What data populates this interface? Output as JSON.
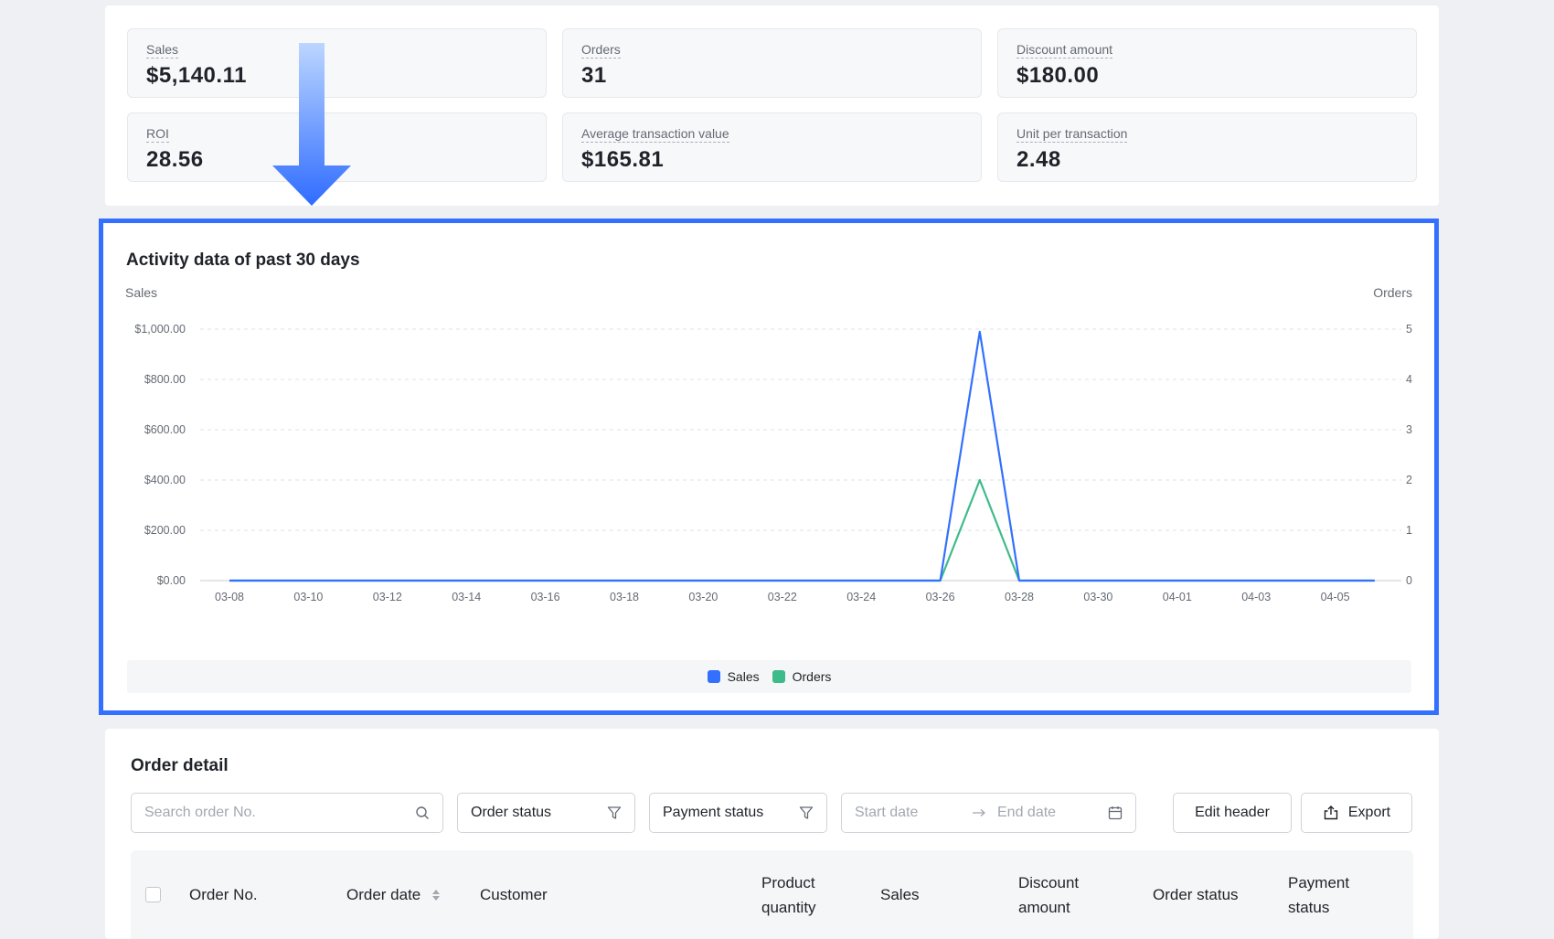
{
  "metrics": {
    "sales": {
      "label": "Sales",
      "value": "$5,140.11"
    },
    "orders": {
      "label": "Orders",
      "value": "31"
    },
    "discount": {
      "label": "Discount amount",
      "value": "$180.00"
    },
    "roi": {
      "label": "ROI",
      "value": "28.56"
    },
    "atv": {
      "label": "Average transaction value",
      "value": "$165.81"
    },
    "upt": {
      "label": "Unit per transaction",
      "value": "2.48"
    }
  },
  "chart": {
    "title": "Activity data of past 30 days"
  },
  "chart_data": {
    "type": "line",
    "title": "Activity data of past 30 days",
    "ylabel_left": "Sales",
    "ylabel_right": "Orders",
    "yticks_left": [
      "$0.00",
      "$200.00",
      "$400.00",
      "$600.00",
      "$800.00",
      "$1,000.00"
    ],
    "yticks_right": [
      "0",
      "1",
      "2",
      "3",
      "4",
      "5"
    ],
    "ylim_left": [
      0,
      1000
    ],
    "ylim_right": [
      0,
      5
    ],
    "xticks": [
      "03-08",
      "03-10",
      "03-12",
      "03-14",
      "03-16",
      "03-18",
      "03-20",
      "03-22",
      "03-24",
      "03-26",
      "03-28",
      "03-30",
      "04-01",
      "04-03",
      "04-05"
    ],
    "x": [
      "03-08",
      "03-09",
      "03-10",
      "03-11",
      "03-12",
      "03-13",
      "03-14",
      "03-15",
      "03-16",
      "03-17",
      "03-18",
      "03-19",
      "03-20",
      "03-21",
      "03-22",
      "03-23",
      "03-24",
      "03-25",
      "03-26",
      "03-27",
      "03-28",
      "03-29",
      "03-30",
      "03-31",
      "04-01",
      "04-02",
      "04-03",
      "04-04",
      "04-05",
      "04-06"
    ],
    "series": [
      {
        "name": "Sales",
        "axis": "left",
        "color": "#3370ff",
        "values": [
          0,
          0,
          0,
          0,
          0,
          0,
          0,
          0,
          0,
          0,
          0,
          0,
          0,
          0,
          0,
          0,
          0,
          0,
          0,
          990,
          0,
          0,
          0,
          0,
          0,
          0,
          0,
          0,
          0,
          0
        ]
      },
      {
        "name": "Orders",
        "axis": "right",
        "color": "#3ebb8a",
        "values": [
          0,
          0,
          0,
          0,
          0,
          0,
          0,
          0,
          0,
          0,
          0,
          0,
          0,
          0,
          0,
          0,
          0,
          0,
          0,
          2,
          0,
          0,
          0,
          0,
          0,
          0,
          0,
          0,
          0,
          0
        ]
      }
    ],
    "grid": true,
    "legend_position": "bottom-center"
  },
  "orders": {
    "title": "Order detail",
    "search_placeholder": "Search order No.",
    "order_status": "Order status",
    "payment_status": "Payment status",
    "start_date_placeholder": "Start date",
    "end_date_placeholder": "End date",
    "edit_header": "Edit header",
    "export": "Export",
    "columns": {
      "order_no": "Order No.",
      "order_date": "Order date",
      "customer": "Customer",
      "product_quantity_1": "Product",
      "product_quantity_2": "quantity",
      "sales": "Sales",
      "discount_1": "Discount",
      "discount_2": "amount",
      "order_status": "Order status",
      "payment_status_1": "Payment",
      "payment_status_2": "status"
    }
  },
  "colors": {
    "accent": "#3370ff",
    "orders_series": "#3ebb8a",
    "arrow_top": "#bcd6ff",
    "arrow_bottom": "#2f6cff"
  }
}
